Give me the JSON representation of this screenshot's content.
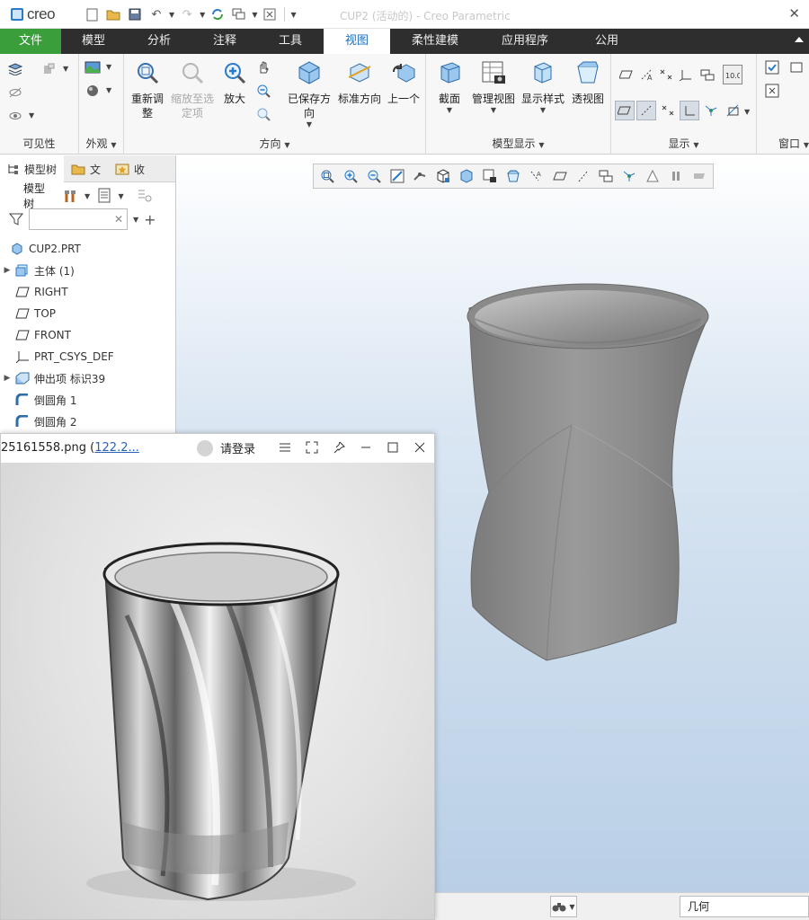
{
  "app": {
    "logo_text": "creo",
    "window_title": "CUP2 (活动的) - Creo Parametric",
    "close_glyph": "✕"
  },
  "tabs": [
    {
      "label": "文件"
    },
    {
      "label": "模型"
    },
    {
      "label": "分析"
    },
    {
      "label": "注释"
    },
    {
      "label": "工具"
    },
    {
      "label": "视图"
    },
    {
      "label": "柔性建模"
    },
    {
      "label": "应用程序"
    },
    {
      "label": "公用"
    }
  ],
  "ribbon": {
    "visibility": {
      "label": "可见性"
    },
    "appearance": {
      "label": "外观"
    },
    "orientation": {
      "label": "方向",
      "refit": "重新调整",
      "zoom_to_selected": "缩放至选定项",
      "zoom_in": "放大",
      "saved_orientations": "已保存方向",
      "standard_orientation": "标准方向",
      "previous": "上一个"
    },
    "model_display": {
      "label": "模型显示",
      "section": "截面",
      "manage_views": "管理视图",
      "display_style": "显示样式",
      "perspective": "透视图"
    },
    "show": {
      "label": "显示"
    },
    "window": {
      "label": "窗口"
    }
  },
  "left_panel": {
    "tabs": [
      {
        "label": "模型树"
      },
      {
        "label": "文"
      },
      {
        "label": "收"
      }
    ],
    "toolbar_label": "模型树",
    "filter_placeholder": "",
    "tree": [
      {
        "label": "CUP2.PRT",
        "icon": "part-icon",
        "expandable": false
      },
      {
        "label": "主体 (1)",
        "icon": "body-icon",
        "expandable": true
      },
      {
        "label": "RIGHT",
        "icon": "datum-plane-icon",
        "expandable": false
      },
      {
        "label": "TOP",
        "icon": "datum-plane-icon",
        "expandable": false
      },
      {
        "label": "FRONT",
        "icon": "datum-plane-icon",
        "expandable": false
      },
      {
        "label": "PRT_CSYS_DEF",
        "icon": "csys-icon",
        "expandable": false
      },
      {
        "label": "伸出项 标识39",
        "icon": "extrude-icon",
        "expandable": true
      },
      {
        "label": "倒圆角 1",
        "icon": "round-icon",
        "expandable": false
      },
      {
        "label": "倒圆角 2",
        "icon": "round-icon",
        "expandable": false
      }
    ]
  },
  "image_viewer": {
    "filename_prefix": "25161558.png (",
    "filename_link": "122.2...",
    "login_label": "请登录"
  },
  "status_bar": {
    "selection_filter": "几何"
  },
  "colors": {
    "file_tab": "#3a9e3a",
    "active_tab_text": "#1c6fc2",
    "tab_bar": "#2e2e2e",
    "model_gray": "#8a8a8a"
  }
}
